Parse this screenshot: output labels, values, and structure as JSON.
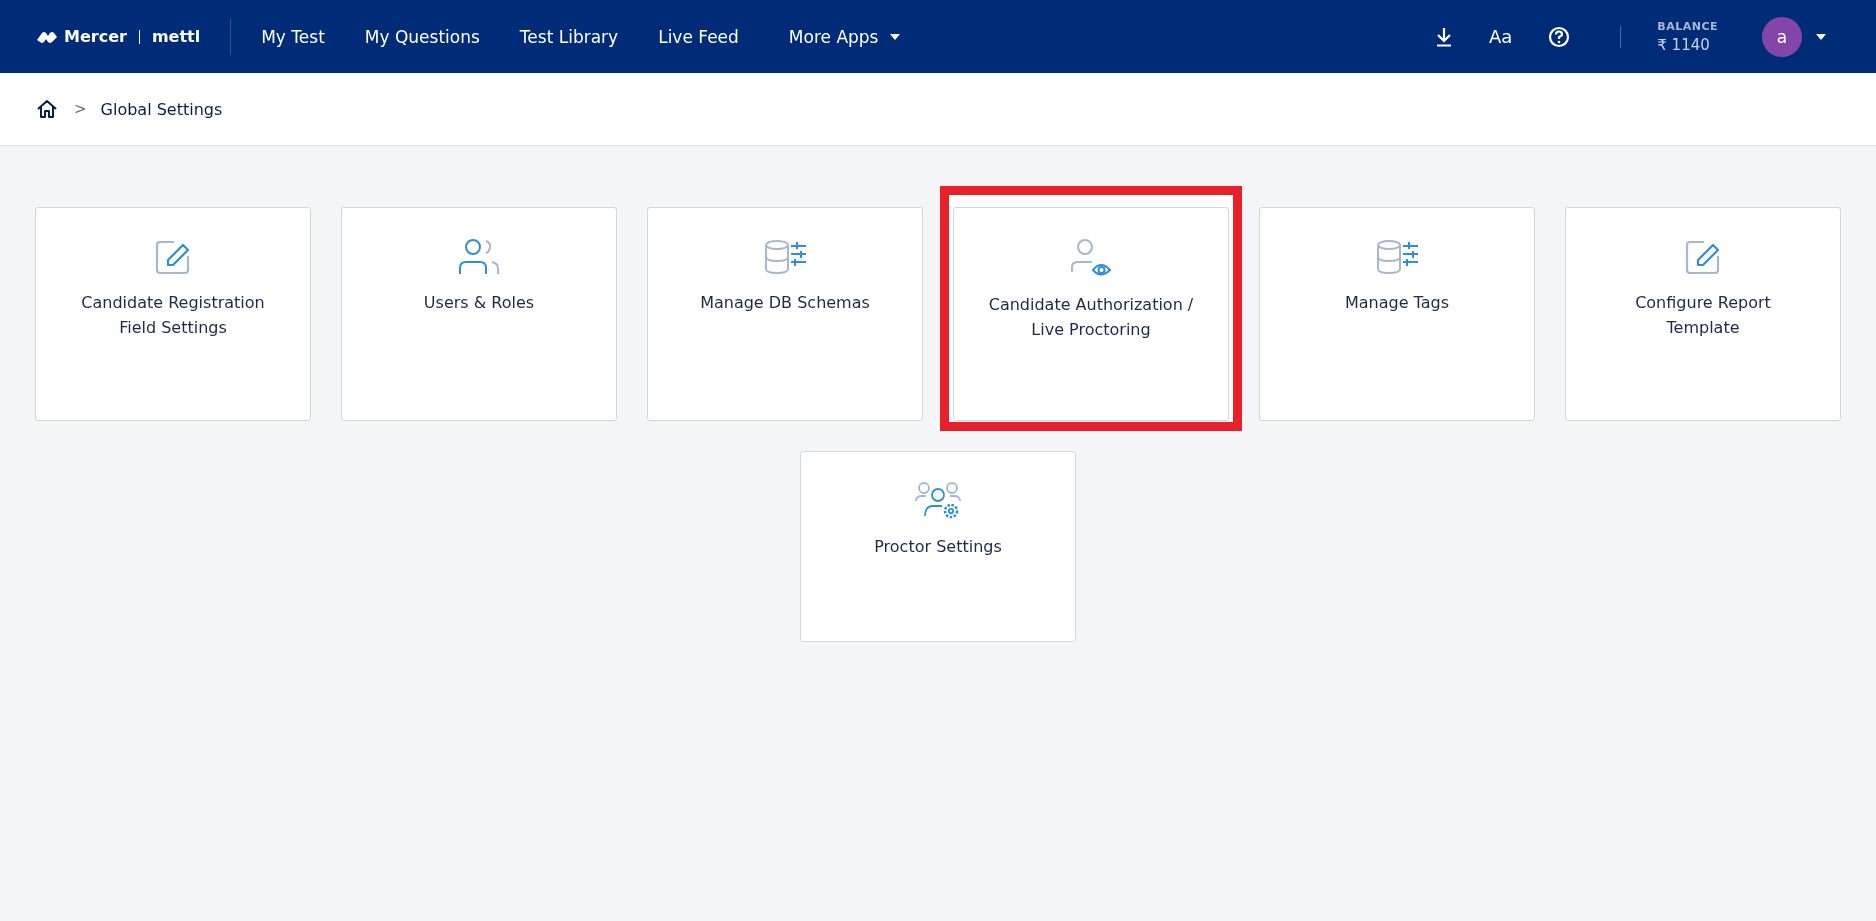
{
  "header": {
    "logo": {
      "brand": "Mercer",
      "product": "mettl"
    },
    "nav": [
      {
        "label": "My Test",
        "dropdown": false
      },
      {
        "label": "My Questions",
        "dropdown": false
      },
      {
        "label": "Test Library",
        "dropdown": false
      },
      {
        "label": "Live Feed",
        "dropdown": false
      },
      {
        "label": "More Apps",
        "dropdown": true
      }
    ],
    "font_toggle": "Aa",
    "balance_label": "BALANCE",
    "balance_value": "₹ 1140",
    "avatar": "a"
  },
  "breadcrumb": {
    "separator": ">",
    "items": [
      "Global Settings"
    ]
  },
  "cards": [
    {
      "kind": "edit",
      "lines": [
        "Candidate Registration",
        "Field Settings"
      ],
      "highlighted": false
    },
    {
      "kind": "users",
      "lines": [
        "Users & Roles"
      ],
      "highlighted": false
    },
    {
      "kind": "database",
      "lines": [
        "Manage DB Schemas"
      ],
      "highlighted": false
    },
    {
      "kind": "user-eye",
      "lines": [
        "Candidate Authorization /",
        "Live Proctoring"
      ],
      "highlighted": true
    },
    {
      "kind": "database",
      "lines": [
        "Manage Tags"
      ],
      "highlighted": false
    },
    {
      "kind": "edit",
      "lines": [
        "Configure Report",
        "Template"
      ],
      "highlighted": false
    },
    {
      "kind": "users-gear",
      "lines": [
        "Proctor Settings"
      ],
      "highlighted": false
    }
  ]
}
